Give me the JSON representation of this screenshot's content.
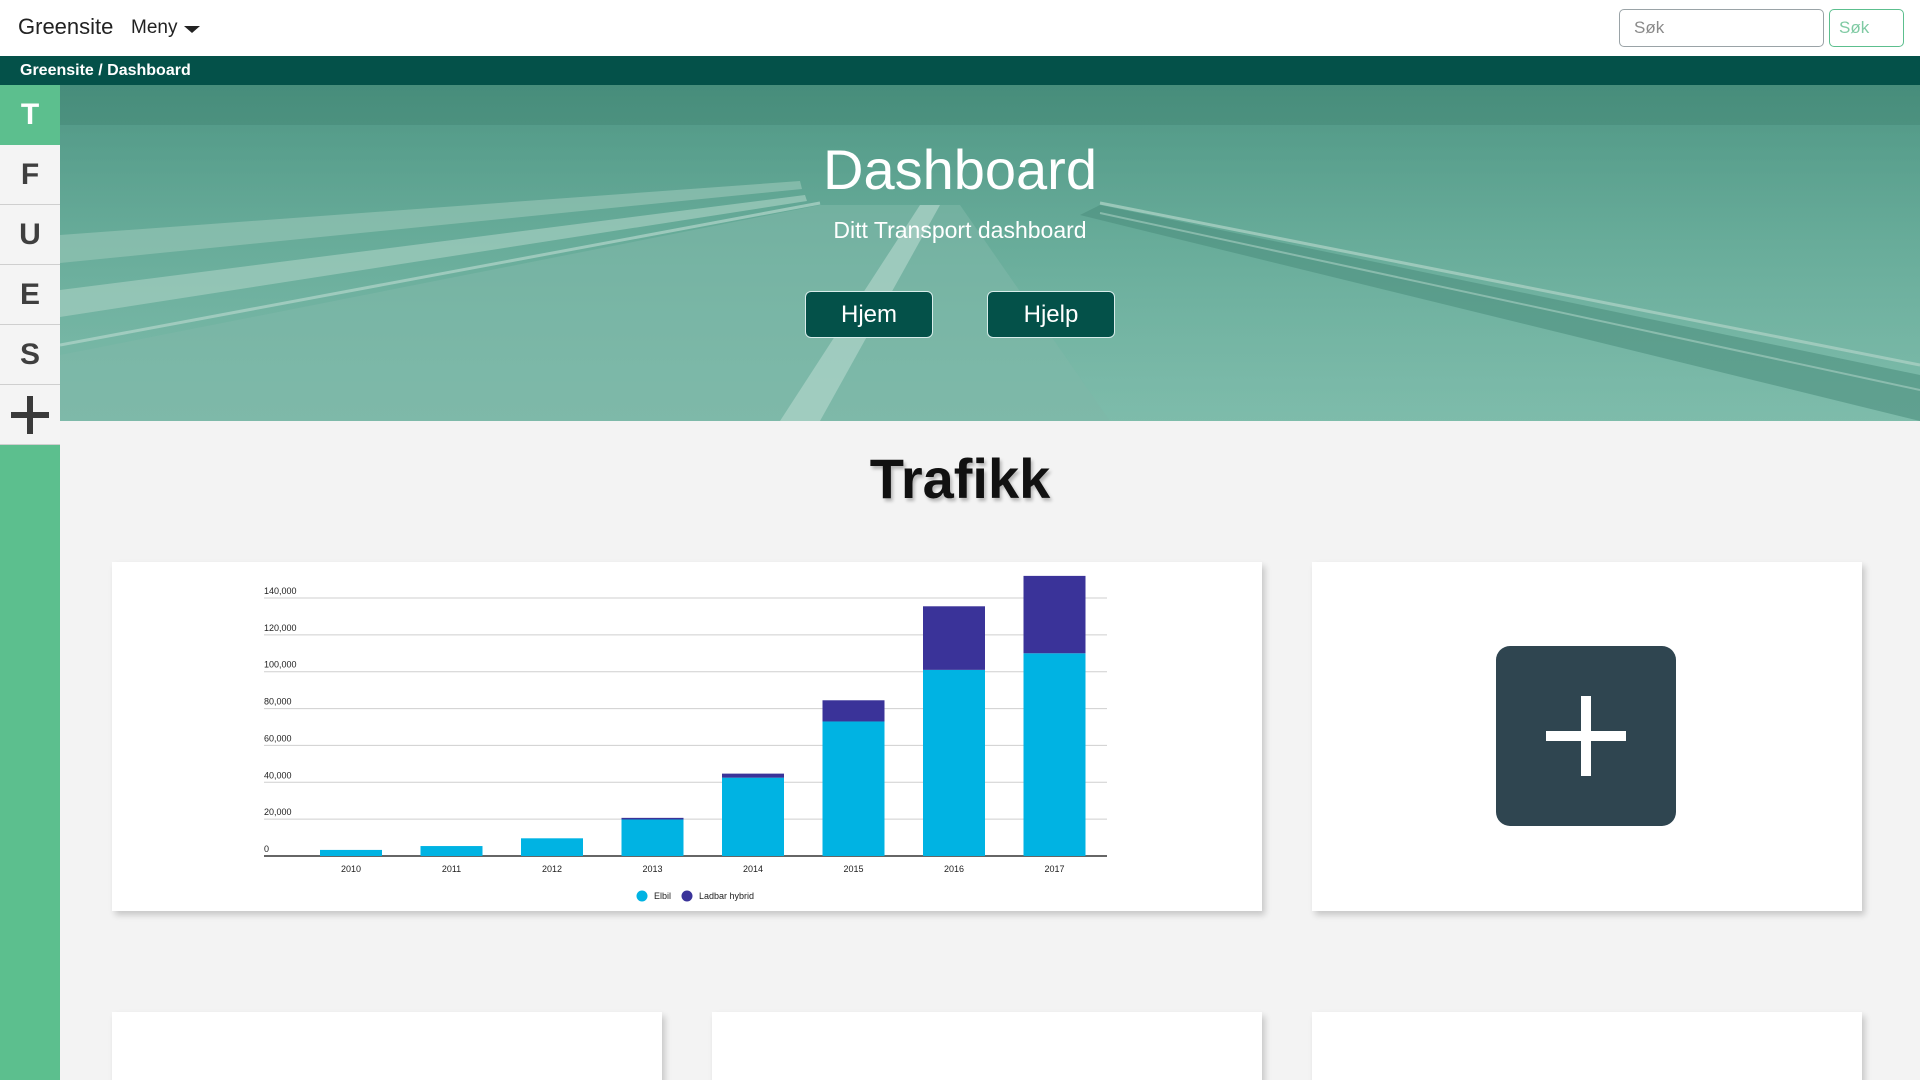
{
  "navbar": {
    "brand": "Greensite",
    "menu_label": "Meny",
    "search_placeholder": "Søk",
    "search_button": "Søk"
  },
  "breadcrumb": "Greensite / Dashboard",
  "sidebar": {
    "items": [
      {
        "label": "T",
        "active": true
      },
      {
        "label": "F",
        "active": false
      },
      {
        "label": "U",
        "active": false
      },
      {
        "label": "E",
        "active": false
      },
      {
        "label": "S",
        "active": false
      }
    ],
    "add_icon": "plus-icon"
  },
  "hero": {
    "title": "Dashboard",
    "subtitle": "Ditt Transport dashboard",
    "buttons": [
      "Hjem",
      "Hjelp"
    ]
  },
  "section_title": "Trafikk",
  "add_widget_icon": "plus-icon",
  "colors": {
    "accent": "#5cbf8e",
    "dark_green": "#045149",
    "series_elbil": "#00b3e3",
    "series_hybrid": "#3a3399",
    "add_tile": "#2f4550"
  },
  "chart_data": {
    "type": "bar",
    "stacked": true,
    "categories": [
      "2010",
      "2011",
      "2012",
      "2013",
      "2014",
      "2015",
      "2016",
      "2017"
    ],
    "series": [
      {
        "name": "Elbil",
        "color": "#00b3e3",
        "values": [
          3300,
          5400,
          9600,
          19800,
          42500,
          73000,
          101000,
          110000
        ]
      },
      {
        "name": "Ladbar hybrid",
        "color": "#3a3399",
        "values": [
          0,
          0,
          0,
          900,
          2200,
          11500,
          34500,
          42000
        ]
      }
    ],
    "yticks": [
      "0",
      "20,000",
      "40,000",
      "60,000",
      "80,000",
      "100,000",
      "120,000",
      "140,000"
    ],
    "ylim": [
      0,
      140000
    ],
    "grid": true,
    "legend": "bottom"
  }
}
